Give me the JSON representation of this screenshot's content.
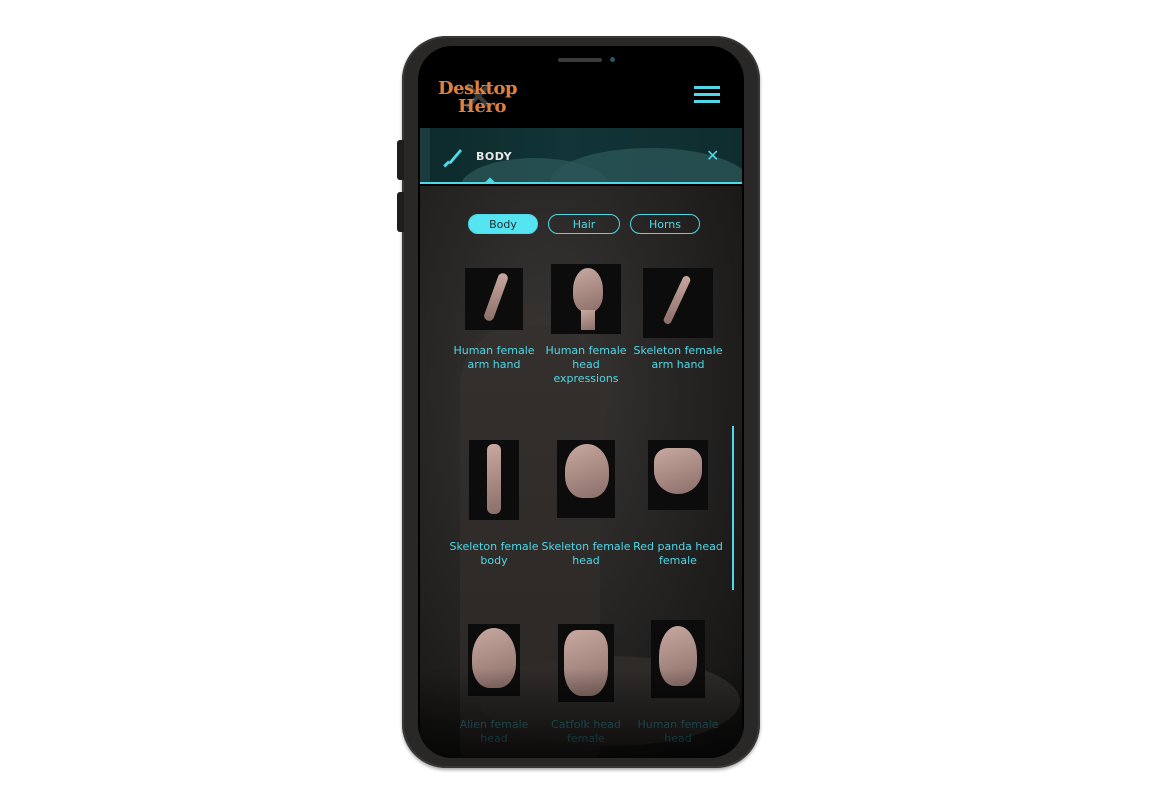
{
  "app": {
    "logo_line1": "Desktop",
    "logo_line2": "Hero"
  },
  "header": {
    "menu_icon": "hamburger-menu-icon"
  },
  "panel": {
    "icon": "knife-icon",
    "title": "BODY",
    "close_icon": "close-icon",
    "close_glyph": "✕"
  },
  "tabs": [
    {
      "label": "Body",
      "active": true
    },
    {
      "label": "Hair",
      "active": false
    },
    {
      "label": "Horns",
      "active": false
    }
  ],
  "items": [
    {
      "label": "Human female arm hand",
      "thumb": "arm"
    },
    {
      "label": "Human female head expressions",
      "thumb": "head"
    },
    {
      "label": "Skeleton female arm hand",
      "thumb": "arm"
    },
    {
      "label": "Skeleton female body",
      "thumb": "body"
    },
    {
      "label": "Skeleton female head",
      "thumb": "skull"
    },
    {
      "label": "Red panda head female",
      "thumb": "panda"
    },
    {
      "label": "Alien female head",
      "thumb": "alien"
    },
    {
      "label": "Catfolk head female",
      "thumb": "cat"
    },
    {
      "label": "Human female head",
      "thumb": "head"
    }
  ],
  "colors": {
    "accent": "#4fd8e8",
    "logo": "#e0803c",
    "background": "#000000"
  }
}
